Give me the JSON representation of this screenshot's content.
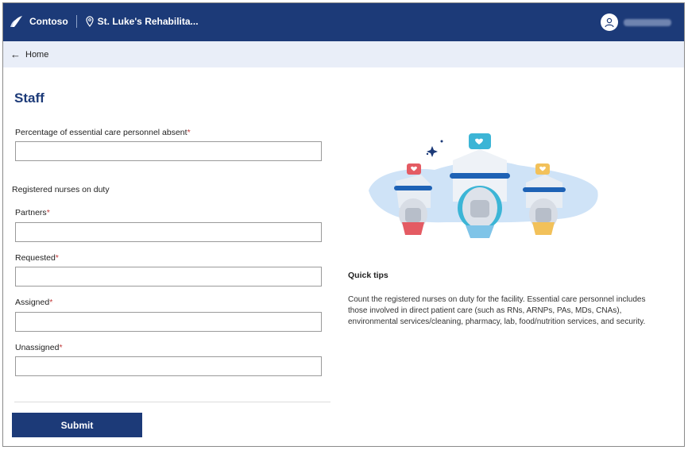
{
  "header": {
    "brand": "Contoso",
    "facility": "St. Luke's Rehabilita..."
  },
  "nav": {
    "back_label": "Home"
  },
  "page": {
    "title": "Staff"
  },
  "form": {
    "absent_label": "Percentage of essential care personnel absent",
    "section_label": "Registered nurses on duty",
    "partners_label": "Partners",
    "requested_label": "Requested",
    "assigned_label": "Assigned",
    "unassigned_label": "Unassigned",
    "required_marker": "*",
    "values": {
      "absent": "",
      "partners": "",
      "requested": "",
      "assigned": "",
      "unassigned": ""
    },
    "submit_label": "Submit"
  },
  "tips": {
    "title": "Quick tips",
    "body": "Count the registered nurses on duty for the facility. Essential care personnel includes those involved in direct patient care (such as RNs, ARNPs, PAs, MDs, CNAs), environmental services/cleaning, pharmacy, lab, food/nutrition services, and security."
  },
  "colors": {
    "brand": "#1c3a78",
    "required": "#c23b3b",
    "nav_bg": "#e9eef8"
  },
  "icons": {
    "logo": "contoso-leaf-icon",
    "location": "location-pin-icon",
    "avatar": "user-avatar-icon",
    "back": "back-arrow-icon"
  }
}
